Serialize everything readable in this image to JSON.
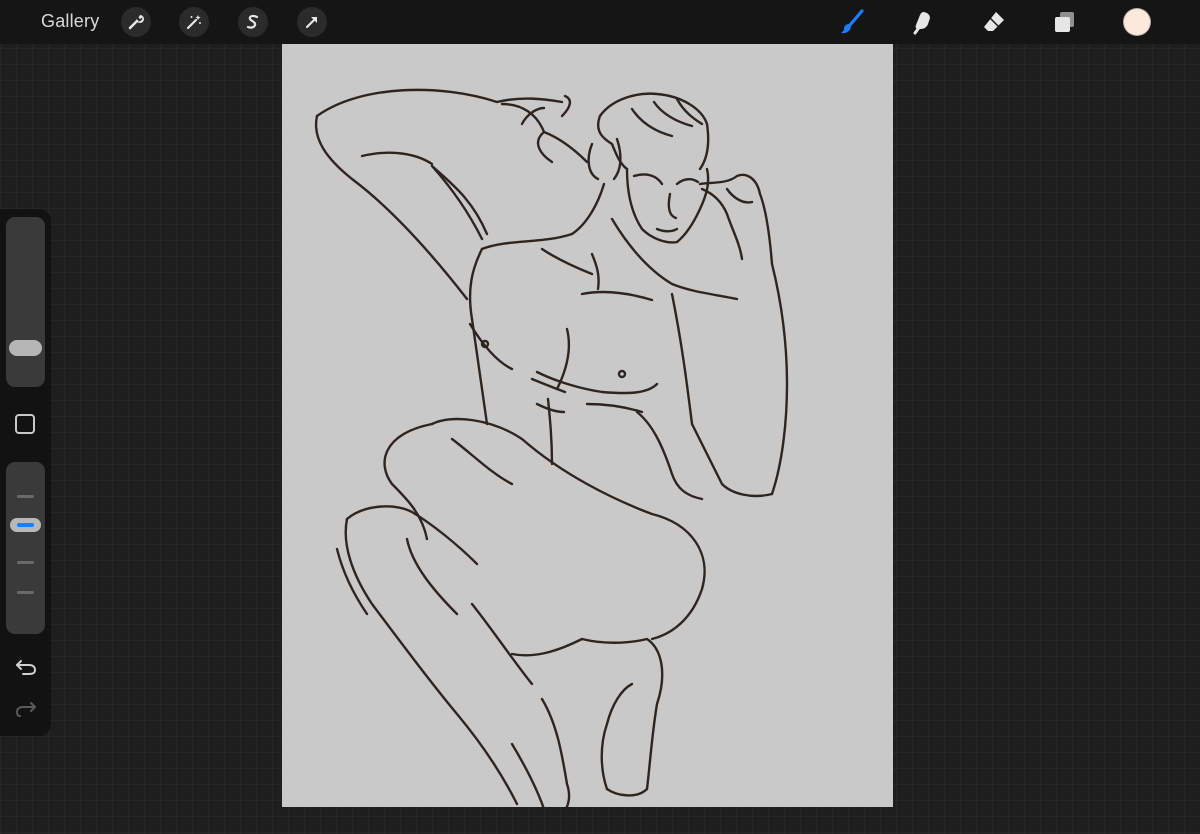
{
  "toolbar": {
    "gallery_label": "Gallery",
    "left_icons": [
      "wrench-icon",
      "magic-wand-icon",
      "selection-s-icon",
      "transform-arrow-icon"
    ],
    "right_icons": [
      "brush-icon",
      "smudge-icon",
      "eraser-icon",
      "layers-icon"
    ],
    "active_tool": "brush",
    "active_color": "#1a7cff",
    "current_color": "#fde8dc"
  },
  "sidebar": {
    "brush_size_level": 0.78,
    "opacity_level": 0.5
  },
  "canvas": {
    "background": "#c9c9c9",
    "stroke_color": "#2e2520"
  }
}
